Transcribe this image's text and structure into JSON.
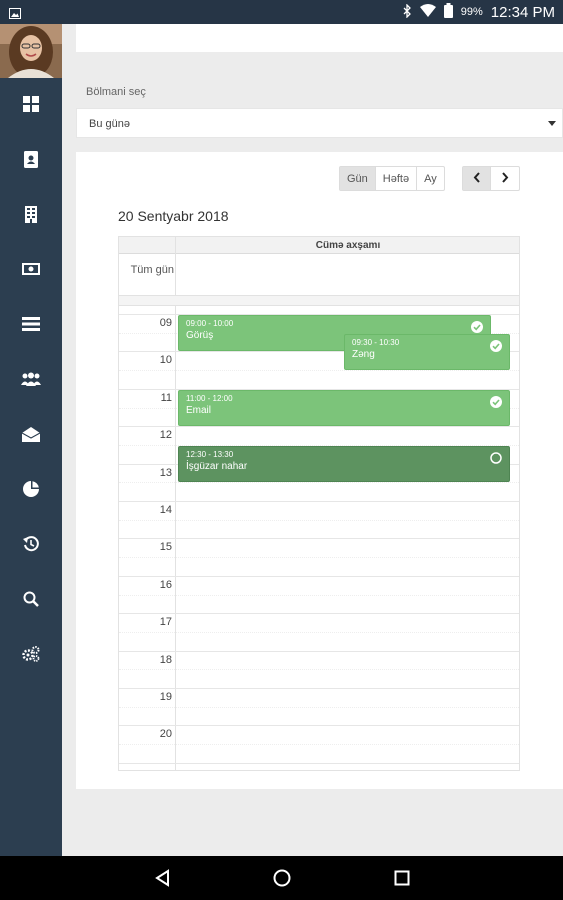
{
  "status_bar": {
    "battery": "99%",
    "time": "12:34 PM"
  },
  "sidebar": {
    "icons": [
      "dashboard-icon",
      "contacts-icon",
      "building-icon",
      "money-icon",
      "list-icon",
      "users-icon",
      "mail-icon",
      "pie-chart-icon",
      "history-icon",
      "search-icon",
      "settings-icon"
    ]
  },
  "filter": {
    "label": "Bölmani seç",
    "selected": "Bu günə"
  },
  "calendar": {
    "views": [
      "Gün",
      "Həftə",
      "Ay"
    ],
    "active_view": "Gün",
    "date_title": "20 Sentyabr 2018",
    "day_header": "Cümə axşamı",
    "all_day_label": "Tüm gün",
    "hours": [
      "09",
      "10",
      "11",
      "12",
      "13",
      "14",
      "15",
      "16",
      "17",
      "18",
      "19",
      "20"
    ],
    "events": [
      {
        "time": "09:00 - 10:00",
        "title": "Görüş",
        "status": "done"
      },
      {
        "time": "09:30 - 10:30",
        "title": "Zəng",
        "status": "done"
      },
      {
        "time": "11:00 - 12:00",
        "title": "Email",
        "status": "done"
      },
      {
        "time": "12:30 - 13:30",
        "title": "İşgüzar nahar",
        "status": "pending"
      }
    ]
  }
}
